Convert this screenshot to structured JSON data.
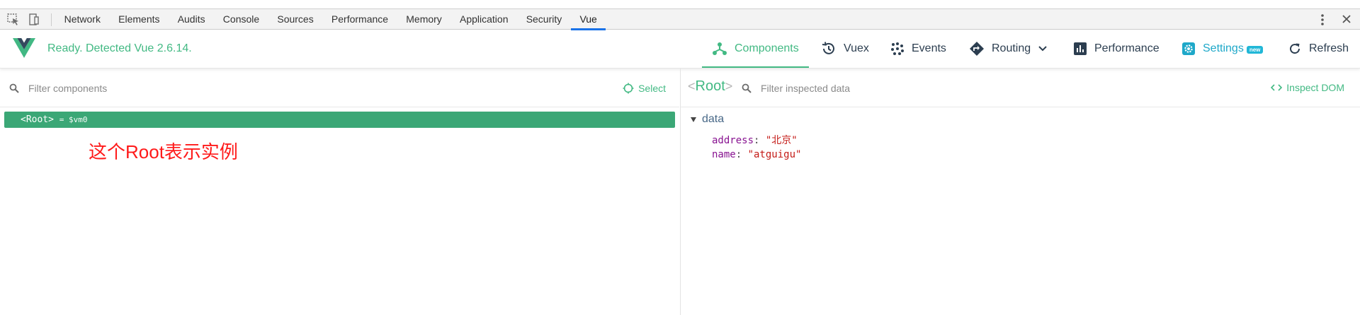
{
  "devtools": {
    "tabs": [
      {
        "label": "Network",
        "active": false
      },
      {
        "label": "Elements",
        "active": false
      },
      {
        "label": "Audits",
        "active": false
      },
      {
        "label": "Console",
        "active": false
      },
      {
        "label": "Sources",
        "active": false
      },
      {
        "label": "Performance",
        "active": false
      },
      {
        "label": "Memory",
        "active": false
      },
      {
        "label": "Application",
        "active": false
      },
      {
        "label": "Security",
        "active": false
      },
      {
        "label": "Vue",
        "active": true
      }
    ],
    "icons": {
      "inspect": "inspect-element-icon",
      "device": "device-toolbar-icon",
      "more": "vertical-ellipsis-icon",
      "close": "close-icon"
    },
    "accent": "#1a73e8"
  },
  "vue_header": {
    "status": "Ready. Detected Vue 2.6.14.",
    "nav": {
      "components": "Components",
      "vuex": "Vuex",
      "events": "Events",
      "routing": "Routing",
      "performance": "Performance",
      "settings": "Settings",
      "settings_badge": "new",
      "refresh": "Refresh"
    },
    "colors": {
      "brand": "#42b983",
      "settings": "#1ea8c9"
    }
  },
  "components_pane": {
    "filter_placeholder": "Filter components",
    "select_label": "Select",
    "root_row": {
      "open": "<",
      "name": "Root",
      "close": ">",
      "assign": "= $vm0"
    },
    "annotation": "这个Root表示实例",
    "annotation_color": "#ff1a1a"
  },
  "inspector_pane": {
    "root": {
      "open": "<",
      "name": "Root",
      "close": ">"
    },
    "filter_placeholder": "Filter inspected data",
    "inspect_dom": "Inspect DOM",
    "section": "data",
    "props": [
      {
        "key": "address",
        "value": "\"北京\""
      },
      {
        "key": "name",
        "value": "\"atguigu\""
      }
    ]
  }
}
